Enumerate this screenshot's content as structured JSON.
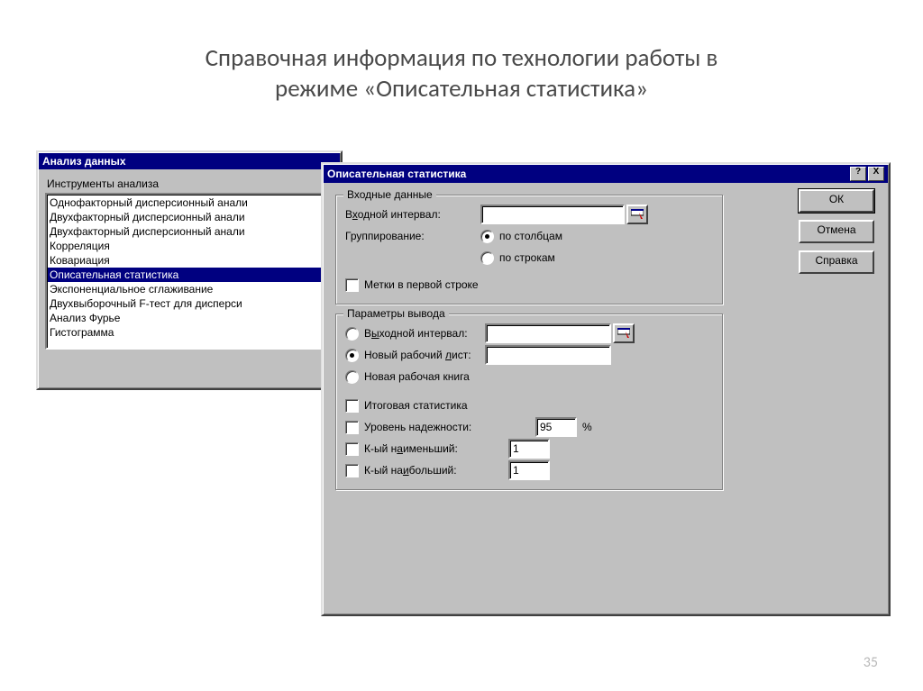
{
  "page": {
    "title_line1": "Справочная информация по технологии работы в",
    "title_line2": "режиме «Описательная статистика»",
    "number": "35"
  },
  "analysis_dialog": {
    "title": "Анализ данных",
    "tools_label": "Инструменты анализа",
    "items": [
      "Однофакторный дисперсионный анали",
      "Двухфакторный дисперсионный анали",
      "Двухфакторный дисперсионный анали",
      "Корреляция",
      "Ковариация",
      "Описательная статистика",
      "Экспоненциальное сглаживание",
      "Двухвыборочный F-тест для дисперси",
      "Анализ Фурье",
      "Гистограмма"
    ],
    "selected_index": 5
  },
  "desc_dialog": {
    "title": "Описательная статистика",
    "help_symbol": "?",
    "close_symbol": "X",
    "buttons": {
      "ok": "ОК",
      "cancel": "Отмена",
      "help": "Справка"
    },
    "input_group": {
      "legend": "Входные данные",
      "input_range_label": "Входной интервал:",
      "input_range_ul": "х",
      "input_range_value": "",
      "grouping_label": "Группирование:",
      "group_cols": "по столбцам",
      "group_cols_ul": "б",
      "group_rows": "по строкам",
      "group_rows_ul": "с",
      "group_selected": "cols",
      "labels_first_row": "Метки в первой строке",
      "labels_first_row_ul": "М",
      "labels_checked": false
    },
    "output_group": {
      "legend": "Параметры вывода",
      "out_range": "Выходной интервал:",
      "out_range_ul": "ы",
      "out_range_value": "",
      "new_sheet": "Новый рабочий лист:",
      "new_sheet_ul": "л",
      "new_sheet_value": "",
      "new_book": "Новая рабочая книга",
      "new_book_ul": "к",
      "out_selected": "sheet",
      "summary_stats": "Итоговая статистика",
      "summary_stats_ul": "И",
      "confidence": "Уровень надежности:",
      "confidence_value": "95",
      "percent": "%",
      "k_smallest": "К-ый наименьший:",
      "k_smallest_ul": "а",
      "k_smallest_value": "1",
      "k_largest": "К-ый наибольший:",
      "k_largest_ul": "и",
      "k_largest_value": "1"
    }
  }
}
